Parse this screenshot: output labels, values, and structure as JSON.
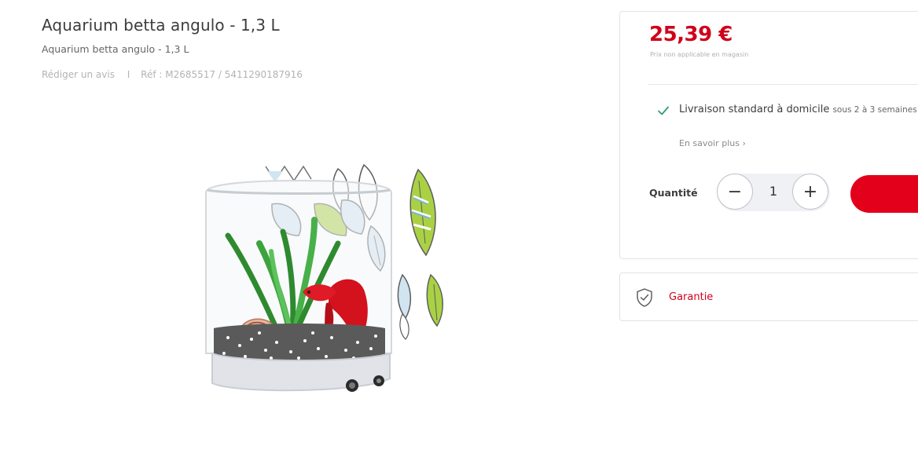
{
  "product": {
    "title": "Aquarium betta angulo - 1,3 L",
    "subtitle": "Aquarium betta angulo - 1,3 L",
    "review_link": "Rédiger un avis",
    "separator": "I",
    "reference": "Réf : M2685517 / 5411290187916"
  },
  "buy": {
    "price": "25,39 €",
    "price_note": "Prix non applicable en magasin",
    "delivery_label": "Livraison standard à domicile",
    "delivery_delay": "sous 2 à 3 semaines",
    "learn_more": "En savoir plus",
    "learn_more_chevron": "›",
    "quantity_label": "Quantité",
    "quantity_value": "1",
    "minus_symbol": "−",
    "plus_symbol": "+"
  },
  "warranty": {
    "label": "Garantie"
  },
  "colors": {
    "price": "#d0021b",
    "accent": "#e2001a",
    "check": "#2e9e6e"
  },
  "icons": [
    "check-icon",
    "shield-check-icon",
    "minus-icon",
    "plus-icon",
    "chevron-right-icon"
  ]
}
